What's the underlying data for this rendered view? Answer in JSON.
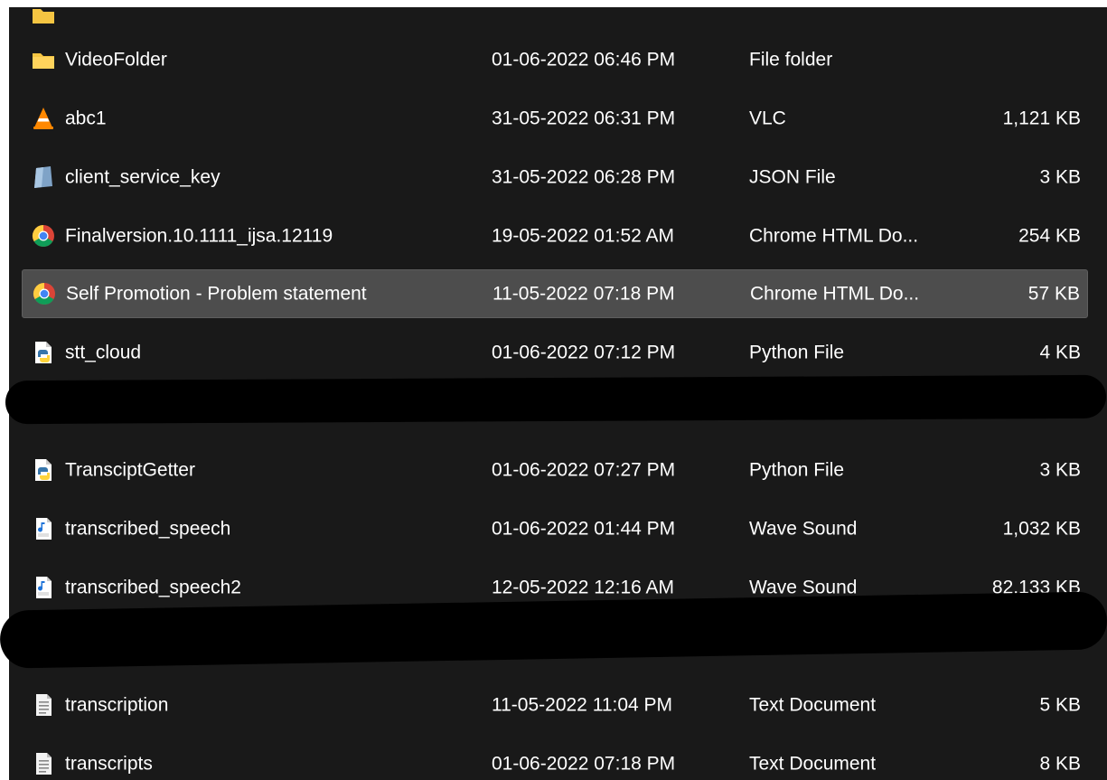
{
  "colors": {
    "background": "#191919",
    "selected_row": "#4d4d4d",
    "text": "#ffffff",
    "redaction": "#000000"
  },
  "files": [
    {
      "name": "VideoFolder",
      "date": "01-06-2022 06:46 PM",
      "type": "File folder",
      "size": "",
      "icon": "folder-icon"
    },
    {
      "name": "abc1",
      "date": "31-05-2022 06:31 PM",
      "type": "VLC",
      "size": "1,121 KB",
      "icon": "vlc-icon"
    },
    {
      "name": "client_service_key",
      "date": "31-05-2022 06:28 PM",
      "type": "JSON File",
      "size": "3 KB",
      "icon": "json-file-icon"
    },
    {
      "name": "Finalversion.10.1111_ijsa.12119",
      "date": "19-05-2022 01:52 AM",
      "type": "Chrome HTML Do...",
      "size": "254 KB",
      "icon": "chrome-icon"
    },
    {
      "name": "Self Promotion - Problem statement",
      "date": "11-05-2022 07:18 PM",
      "type": "Chrome HTML Do...",
      "size": "57 KB",
      "icon": "chrome-icon",
      "selected": true
    },
    {
      "name": "stt_cloud",
      "date": "01-06-2022 07:12 PM",
      "type": "Python File",
      "size": "4 KB",
      "icon": "python-file-icon"
    },
    {
      "name": "TransciptGetter",
      "date": "01-06-2022 07:27 PM",
      "type": "Python File",
      "size": "3 KB",
      "icon": "python-file-icon"
    },
    {
      "name": "transcribed_speech",
      "date": "01-06-2022 01:44 PM",
      "type": "Wave Sound",
      "size": "1,032 KB",
      "icon": "wave-sound-icon"
    },
    {
      "name": "transcribed_speech2",
      "date": "12-05-2022 12:16 AM",
      "type": "Wave Sound",
      "size": "82,133 KB",
      "icon": "wave-sound-icon"
    },
    {
      "name": "transcription",
      "date": "11-05-2022 11:04 PM",
      "type": "Text Document",
      "size": "5 KB",
      "icon": "text-document-icon"
    },
    {
      "name": "transcripts",
      "date": "01-06-2022 07:18 PM",
      "type": "Text Document",
      "size": "8 KB",
      "icon": "text-document-icon"
    }
  ]
}
